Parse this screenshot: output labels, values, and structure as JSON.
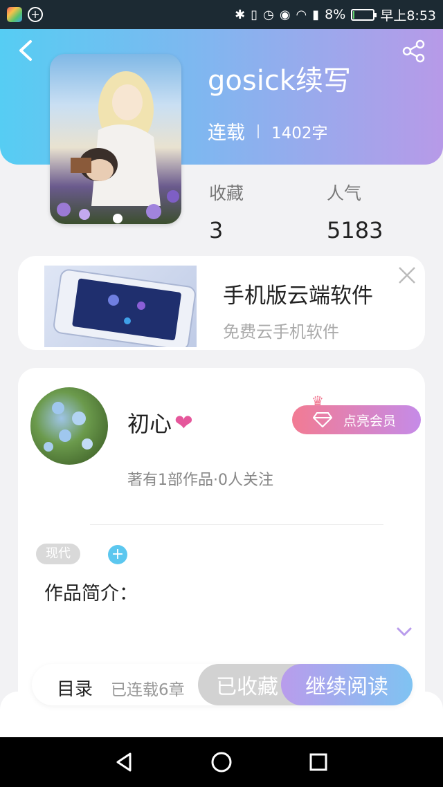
{
  "status_bar": {
    "battery": "8%",
    "time": "早上8:53",
    "battery_level": 0.08
  },
  "header": {
    "back_icon": "chevron-left-icon",
    "share_icon": "share-icon"
  },
  "book": {
    "title": "gosick续写",
    "status": "连载",
    "word_count": "1402字"
  },
  "stats": {
    "favorites_label": "收藏",
    "favorites_value": "3",
    "popularity_label": "人气",
    "popularity_value": "5183"
  },
  "ad": {
    "title": "手机版云端软件",
    "subtitle": "免费云手机软件"
  },
  "author": {
    "name": "初心",
    "member_button": "点亮会员",
    "meta": "著有1部作品·0人关注"
  },
  "tags": [
    "现代"
  ],
  "intro_label": "作品简介：",
  "actions": {
    "catalog": "目录",
    "chapters": "已连载6章",
    "saved": "已收藏",
    "continue": "继续阅读"
  },
  "colors": {
    "header_start": "#56cdf3",
    "header_end": "#b79ae8",
    "member_start": "#f27b93",
    "member_end": "#c58be8"
  }
}
